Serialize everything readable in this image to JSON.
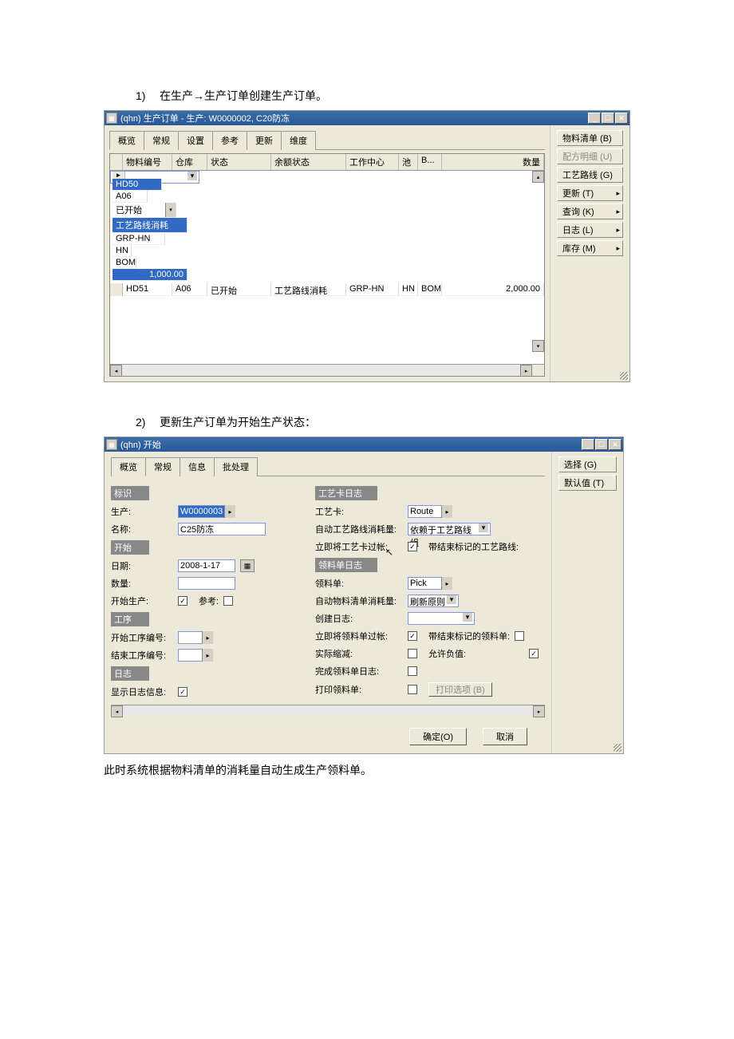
{
  "step1": "在生产→生产订单创建生产订单。",
  "step2": "更新生产订单为开始生产状态：",
  "footer": "此时系统根据物料清单的消耗量自动生成生产领料单。",
  "win1": {
    "title": "(qhn) 生产订单 - 生产: W0000002, C20防冻",
    "tabs": [
      "概览",
      "常规",
      "设置",
      "参考",
      "更新",
      "维度"
    ],
    "columns": [
      "物料编号",
      "仓库",
      "状态",
      "余额状态",
      "工作中心",
      "池",
      "B...",
      "数量"
    ],
    "rows": [
      {
        "mat": "HD50",
        "wh": "A06",
        "st": "已开始",
        "bal": "工艺路线消耗",
        "wc": "GRP-HN",
        "pool": "HN",
        "b": "BOM",
        "qty": "1,000.00"
      },
      {
        "mat": "HD51",
        "wh": "A06",
        "st": "已开始",
        "bal": "工艺路线消耗",
        "wc": "GRP-HN",
        "pool": "HN",
        "b": "BOM",
        "qty": "2,000.00"
      }
    ],
    "side": [
      {
        "l": "物料清单 (B)",
        "d": false,
        "s": false
      },
      {
        "l": "配方明细 (U)",
        "d": true,
        "s": false
      },
      {
        "l": "工艺路线 (G)",
        "d": false,
        "s": false
      },
      {
        "l": "更新 (T)",
        "d": false,
        "s": true
      },
      {
        "l": "查询 (K)",
        "d": false,
        "s": true
      },
      {
        "l": "日志 (L)",
        "d": false,
        "s": true
      },
      {
        "l": "库存 (M)",
        "d": false,
        "s": true
      }
    ]
  },
  "win2": {
    "title": "(qhn) 开始",
    "tabs": [
      "概览",
      "常规",
      "信息",
      "批处理"
    ],
    "side": [
      {
        "l": "选择 (G)"
      },
      {
        "l": "默认值 (T)"
      }
    ],
    "left": {
      "sec_id": "标识",
      "prod_lbl": "生产:",
      "prod_val": "W0000003",
      "name_lbl": "名称:",
      "name_val": "C25防冻",
      "sec_start": "开始",
      "date_lbl": "日期:",
      "date_val": "2008-1-17",
      "qty_lbl": "数量:",
      "qty_val": "",
      "startprod_lbl": "开始生产:",
      "ref_lbl": "参考:",
      "sec_op": "工序",
      "opfrom_lbl": "开始工序编号:",
      "opfrom_val": "",
      "opto_lbl": "结束工序编号:",
      "opto_val": "",
      "sec_log": "日志",
      "showlog_lbl": "显示日志信息:"
    },
    "right": {
      "sec_route": "工艺卡日志",
      "route_lbl": "工艺卡:",
      "route_val": "Route",
      "auto_route_lbl": "自动工艺路线消耗量:",
      "auto_route_val": "依赖于工艺路线组",
      "postcard_lbl": "立即将工艺卡过帐:",
      "endroute_lbl": "带结束标记的工艺路线:",
      "sec_pick": "领料单日志",
      "pick_lbl": "领料单:",
      "pick_val": "Pick",
      "auto_bom_lbl": "自动物料清单消耗量:",
      "auto_bom_val": "刷新原则",
      "create_lbl": "创建日志:",
      "create_val": "",
      "postpick_lbl": "立即将领料单过帐:",
      "endpick_lbl": "带结束标记的领料单:",
      "reduce_lbl": "实际缩减:",
      "neg_lbl": "允许负值:",
      "complete_lbl": "完成领料单日志:",
      "print_lbl": "打印领料单:",
      "print_opt": "打印选项 (B)"
    },
    "ok": "确定(O)",
    "cancel": "取消"
  }
}
